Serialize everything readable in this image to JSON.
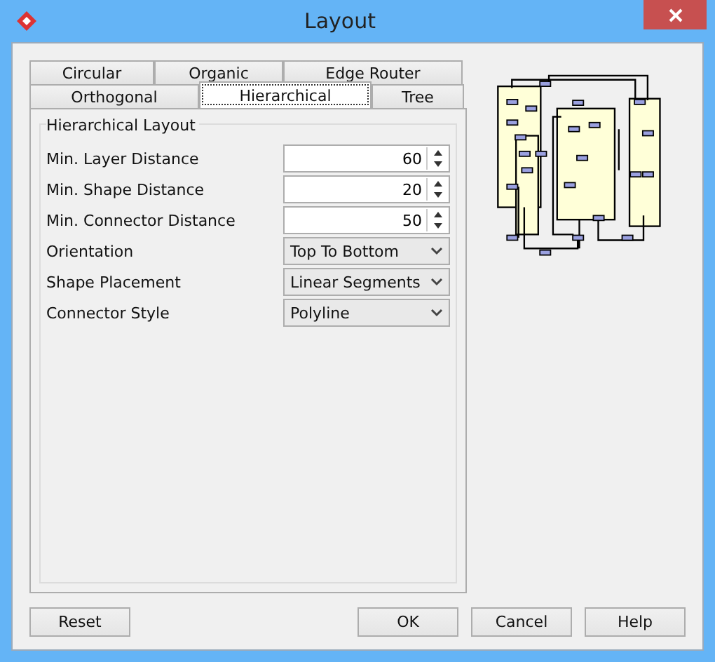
{
  "window": {
    "title": "Layout"
  },
  "tab_rows": [
    [
      {
        "label": "Circular",
        "selected": false
      },
      {
        "label": "Organic",
        "selected": false
      },
      {
        "label": "Edge Router",
        "selected": false
      }
    ],
    [
      {
        "label": "Orthogonal",
        "selected": false
      },
      {
        "label": "Hierarchical",
        "selected": true
      },
      {
        "label": "Tree",
        "selected": false
      }
    ]
  ],
  "group": {
    "title": "Hierarchical Layout",
    "fields": [
      {
        "kind": "spinner",
        "label": "Min. Layer Distance",
        "value": "60"
      },
      {
        "kind": "spinner",
        "label": "Min. Shape Distance",
        "value": "20"
      },
      {
        "kind": "spinner",
        "label": "Min. Connector Distance",
        "value": "50"
      },
      {
        "kind": "dropdown",
        "label": "Orientation",
        "value": "Top To Bottom"
      },
      {
        "kind": "dropdown",
        "label": "Shape Placement",
        "value": "Linear Segments"
      },
      {
        "kind": "dropdown",
        "label": "Connector Style",
        "value": "Polyline"
      }
    ]
  },
  "buttons": {
    "left": [
      "Reset"
    ],
    "right": [
      "OK",
      "Cancel",
      "Help"
    ]
  }
}
